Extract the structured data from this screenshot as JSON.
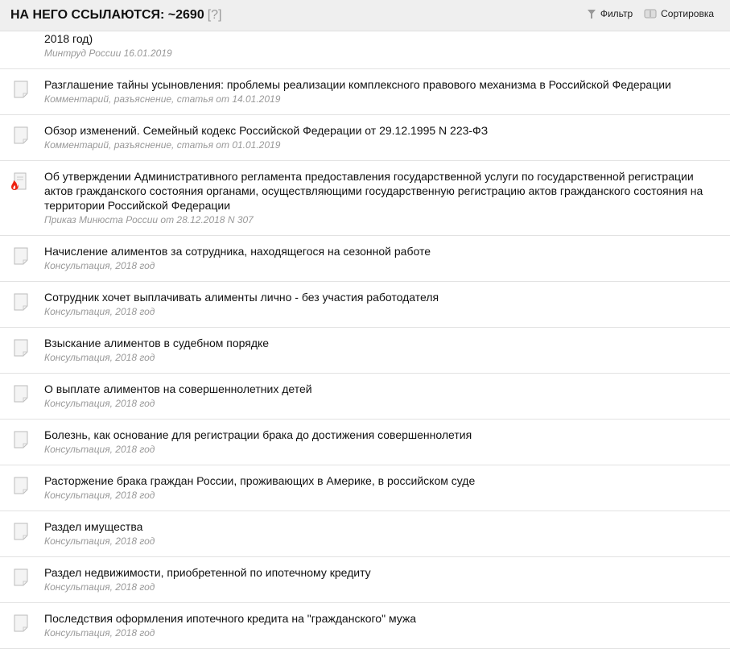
{
  "header": {
    "title": "НА НЕГО ССЫЛАЮТСЯ: ~2690",
    "help": "[?]",
    "filter": "Фильтр",
    "sort": "Сортировка"
  },
  "items": [
    {
      "title": "2018 год)",
      "meta": "Минтруд России 16.01.2019",
      "icon": "none"
    },
    {
      "title": "Разглашение тайны усыновления: проблемы реализации комплексного правового механизма в Российской Федерации",
      "meta": "Комментарий, разъяснение, статья от 14.01.2019",
      "icon": "doc"
    },
    {
      "title": "Обзор изменений. Семейный кодекс Российской Федерации от 29.12.1995 N 223-ФЗ",
      "meta": "Комментарий, разъяснение, статья от 01.01.2019",
      "icon": "doc"
    },
    {
      "title": "Об утверждении Административного регламента предоставления государственной услуги по государственной регистрации актов гражданского состояния органами, осуществляющими государственную регистрацию актов гражданского состояния на территории Российской Федерации",
      "meta": "Приказ Минюста России от 28.12.2018 N 307",
      "icon": "hot"
    },
    {
      "title": "Начисление алиментов за сотрудника, находящегося на сезонной работе",
      "meta": "Консультация, 2018 год",
      "icon": "doc"
    },
    {
      "title": "Сотрудник хочет выплачивать алименты лично - без участия работодателя",
      "meta": "Консультация, 2018 год",
      "icon": "doc"
    },
    {
      "title": "Взыскание алиментов в судебном порядке",
      "meta": "Консультация, 2018 год",
      "icon": "doc"
    },
    {
      "title": "О выплате алиментов на совершеннолетних детей",
      "meta": "Консультация, 2018 год",
      "icon": "doc"
    },
    {
      "title": "Болезнь, как основание для регистрации брака до достижения совершеннолетия",
      "meta": "Консультация, 2018 год",
      "icon": "doc"
    },
    {
      "title": "Расторжение брака граждан России, проживающих в Америке, в российском суде",
      "meta": "Консультация, 2018 год",
      "icon": "doc"
    },
    {
      "title": "Раздел имущества",
      "meta": "Консультация, 2018 год",
      "icon": "doc"
    },
    {
      "title": "Раздел недвижимости, приобретенной по ипотечному кредиту",
      "meta": "Консультация, 2018 год",
      "icon": "doc"
    },
    {
      "title": "Последствия оформления ипотечного кредита на \"гражданского\" мужа",
      "meta": "Консультация, 2018 год",
      "icon": "doc"
    }
  ]
}
